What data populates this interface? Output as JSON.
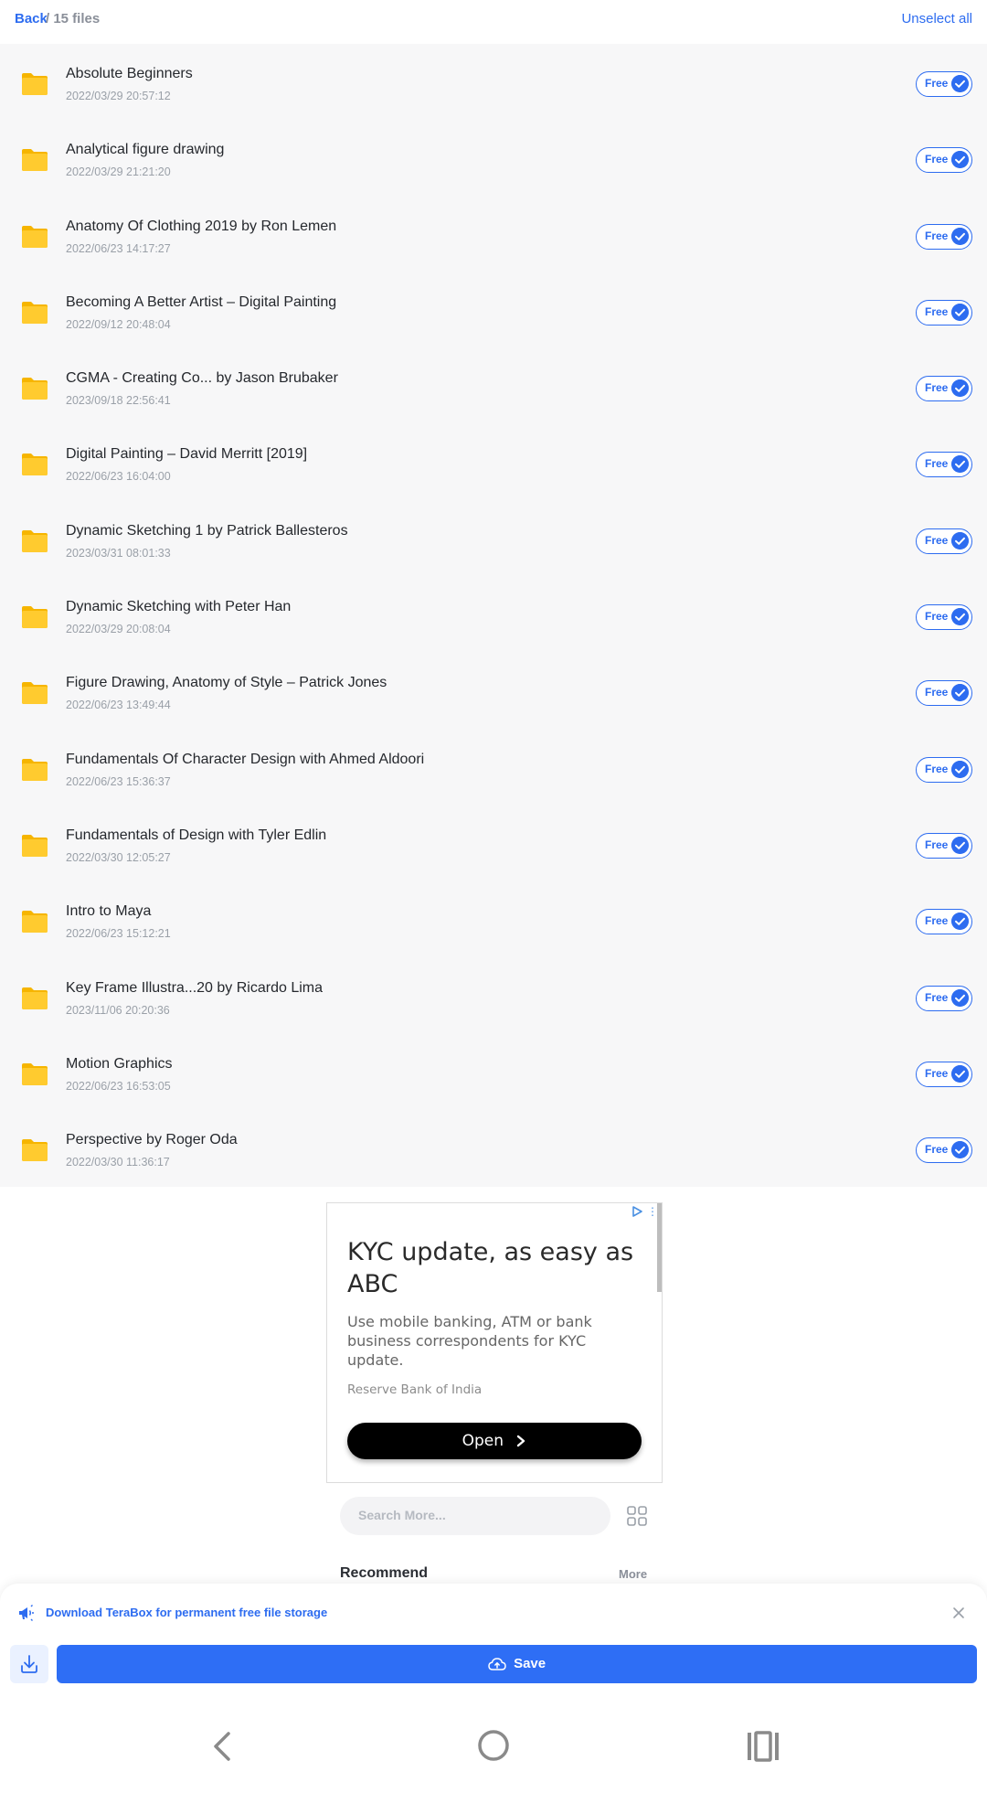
{
  "header": {
    "back_label": "Back",
    "count_label": "/ 15 files",
    "unselect_label": "Unselect all"
  },
  "files": [
    {
      "name": "Absolute Beginners",
      "date": "2022/03/29 20:57:12",
      "badge": "Free"
    },
    {
      "name": "Analytical figure drawing",
      "date": "2022/03/29 21:21:20",
      "badge": "Free"
    },
    {
      "name": "Anatomy Of Clothing 2019 by Ron Lemen",
      "date": "2022/06/23 14:17:27",
      "badge": "Free"
    },
    {
      "name": "Becoming A Better Artist – Digital Painting",
      "date": "2022/09/12 20:48:04",
      "badge": "Free"
    },
    {
      "name": "CGMA - Creating Co... by Jason Brubaker",
      "date": "2023/09/18 22:56:41",
      "badge": "Free"
    },
    {
      "name": "Digital Painting – David Merritt [2019]",
      "date": "2022/06/23 16:04:00",
      "badge": "Free"
    },
    {
      "name": "Dynamic Sketching 1 by Patrick Ballesteros",
      "date": "2023/03/31 08:01:33",
      "badge": "Free"
    },
    {
      "name": "Dynamic Sketching with Peter Han",
      "date": "2022/03/29 20:08:04",
      "badge": "Free"
    },
    {
      "name": "Figure Drawing, Anatomy of Style – Patrick Jones",
      "date": "2022/06/23 13:49:44",
      "badge": "Free"
    },
    {
      "name": "Fundamentals Of Character Design with Ahmed Aldoori",
      "date": "2022/06/23 15:36:37",
      "badge": "Free"
    },
    {
      "name": "Fundamentals of Design with Tyler Edlin",
      "date": "2022/03/30 12:05:27",
      "badge": "Free"
    },
    {
      "name": "Intro to Maya",
      "date": "2022/06/23 15:12:21",
      "badge": "Free"
    },
    {
      "name": "Key Frame Illustra...20 by Ricardo Lima",
      "date": "2023/11/06 20:20:36",
      "badge": "Free"
    },
    {
      "name": "Motion Graphics",
      "date": "2022/06/23 16:53:05",
      "badge": "Free"
    },
    {
      "name": "Perspective by Roger Oda",
      "date": "2022/03/30 11:36:17",
      "badge": "Free"
    }
  ],
  "ad": {
    "title": "KYC update, as easy as ABC",
    "body": "Use mobile banking, ATM or bank business correspondents for KYC update.",
    "source": "Reserve Bank of India",
    "cta": "Open"
  },
  "search": {
    "placeholder": "Search More..."
  },
  "recommend": {
    "title": "Recommend",
    "more": "More"
  },
  "bottom": {
    "promo": "Download TeraBox for permanent free file storage",
    "save_label": "Save"
  },
  "icons": {
    "folder": "folder-icon",
    "check": "check-circle-icon",
    "grid": "grid-icon",
    "megaphone": "megaphone-icon",
    "close": "close-icon",
    "download": "download-icon",
    "cloud_upload": "cloud-upload-icon"
  },
  "colors": {
    "accent": "#2d6cf0",
    "folder": "#ffcb2f",
    "save_button": "#2e6ef5",
    "list_bg": "#f7f7f8"
  }
}
